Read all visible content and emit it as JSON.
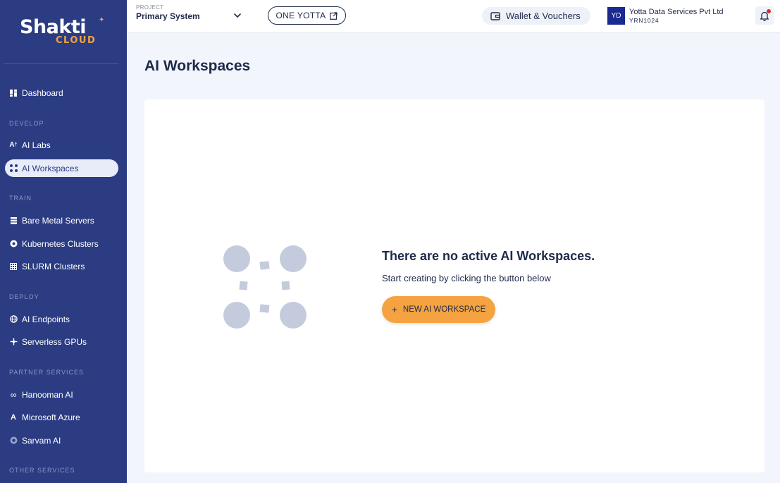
{
  "brand": {
    "name": "Shakti",
    "sub": "CLOUD"
  },
  "colors": {
    "sidebar": "#2b3c83",
    "accent": "#f4a340",
    "avatar": "#1b2a8f",
    "notification": "#d0312d"
  },
  "sidebar": {
    "dashboard": {
      "label": "Dashboard",
      "icon": "dashboard-icon"
    },
    "sections": [
      {
        "label": "DEVELOP"
      },
      {
        "label": "TRAIN"
      },
      {
        "label": "DEPLOY"
      },
      {
        "label": "PARTNER SERVICES"
      },
      {
        "label": "OTHER SERVICES"
      }
    ],
    "items": [
      {
        "label": "AI Labs",
        "icon": "ai-labs-icon"
      },
      {
        "label": "AI Workspaces",
        "icon": "workspaces-icon",
        "active": true
      },
      {
        "label": "Bare Metal Servers",
        "icon": "server-icon"
      },
      {
        "label": "Kubernetes Clusters",
        "icon": "kubernetes-icon"
      },
      {
        "label": "SLURM Clusters",
        "icon": "grid-icon"
      },
      {
        "label": "AI Endpoints",
        "icon": "globe-icon"
      },
      {
        "label": "Serverless GPUs",
        "icon": "serverless-icon"
      },
      {
        "label": "Hanooman AI",
        "icon": "infinity-icon"
      },
      {
        "label": "Microsoft Azure",
        "icon": "azure-icon"
      },
      {
        "label": "Sarvam AI",
        "icon": "sarvam-icon"
      }
    ]
  },
  "topbar": {
    "project_label": "PROJECT",
    "project_value": "Primary System",
    "one_yotta_label": "ONE YOTTA",
    "wallet_label": "Wallet & Vouchers",
    "avatar_initials": "YD",
    "org_name": "Yotta Data Services Pvt Ltd",
    "org_id": "YRN1024"
  },
  "main": {
    "title": "AI Workspaces",
    "empty_title": "There are no active AI Workspaces.",
    "empty_subtitle": "Start creating by clicking the button below",
    "new_button_label": "NEW AI WORKSPACE"
  }
}
